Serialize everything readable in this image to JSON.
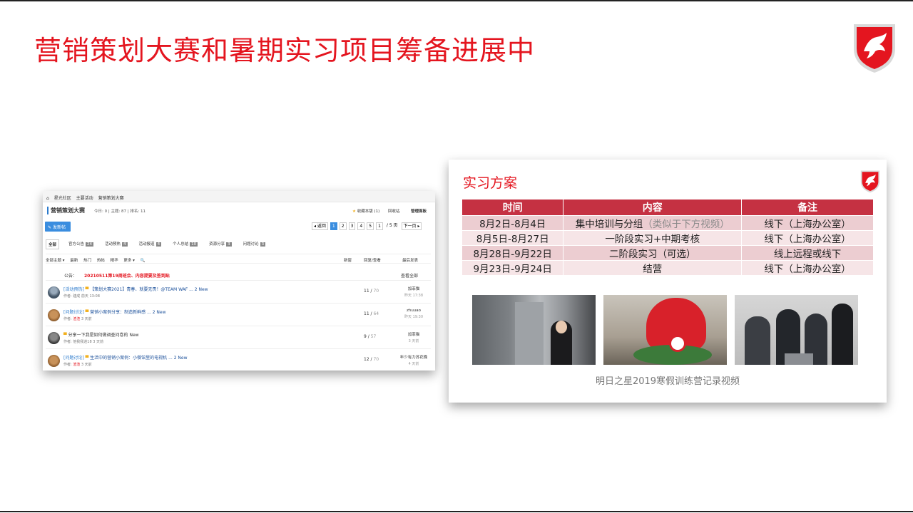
{
  "slide": {
    "title": "营销策划大赛和暑期实习项目筹备进展中",
    "accent": "#e4151f"
  },
  "forum": {
    "breadcrumb": [
      "⌂",
      "星光社区",
      "主要活动",
      "营销策划大赛"
    ],
    "title": "营销策划大赛",
    "stats": "今日: 0 | 主题: 87 | 排名: 11",
    "fav": "收藏本版 (1)",
    "recycle": "回收站",
    "admin": "管理面板",
    "post_button": "发新帖",
    "pager": [
      "◂ 返回",
      "1",
      "2",
      "3",
      "4",
      "5",
      "1",
      "/ 5 页",
      "下一页 ▸"
    ],
    "tabs": [
      {
        "label": "全部",
        "count": ""
      },
      {
        "label": "官方公告",
        "count": "24"
      },
      {
        "label": "活动预热",
        "count": "4"
      },
      {
        "label": "活动报道",
        "count": "4"
      },
      {
        "label": "个人总结",
        "count": "10"
      },
      {
        "label": "资源分享",
        "count": "3"
      },
      {
        "label": "问题讨论",
        "count": "3"
      }
    ],
    "filters": [
      "全部主题 ▾",
      "最新",
      "热门",
      "热帖",
      "精华",
      "更多 ▾",
      "🔍"
    ],
    "col_new": "新窗",
    "col_reply": "回复/查看",
    "col_last": "最后发表",
    "notice_label": "公告：",
    "notice_text": "20210511第19周班会、内容提要及签到贴",
    "notice_more": "查看全部",
    "rows": [
      {
        "tag": "[活动预热]",
        "title": "【策划大赛2021】青春、就要无畏！@TEAM WAF ... 2  New",
        "author_prefix": "作者: ",
        "author": "建成",
        "time": " 前天 13:08",
        "replies": "11",
        "views": "70",
        "last_user": "加菲猫",
        "last_time": "昨天 17:38"
      },
      {
        "tag": "[问题讨论]",
        "title": "营销小案例分享：制造新鲜感 ... 2  New",
        "author_prefix": "作者: ",
        "author": "渣渣",
        "time": " 3 天前",
        "replies": "11",
        "views": "64",
        "last_user": "zhuuao",
        "last_time": "昨天 19:30"
      },
      {
        "tag": "",
        "title": "分享一下我是如何做调查问卷的  New",
        "author_prefix": "作者: ",
        "author": "他我我迷18",
        "time": " 3 天前",
        "replies": "9",
        "views": "57",
        "last_user": "加菲猫",
        "last_time": "3 天前"
      },
      {
        "tag": "[问题讨论]",
        "title": "生活中的营销小案例：小餐馆里的电视机 ... 2  New",
        "author_prefix": "作者: ",
        "author": "渣渣",
        "time": " 3 天前",
        "replies": "12",
        "views": "70",
        "last_user": "年少有力苏花晚",
        "last_time": "4 天前"
      }
    ]
  },
  "plan": {
    "title": "实习方案",
    "headers": [
      "时间",
      "内容",
      "备注"
    ],
    "rows": [
      {
        "time": "8月2日-8月4日",
        "content": "集中培训与分组",
        "content_note": "（类似于下方视频）",
        "note": "线下（上海办公室）"
      },
      {
        "time": "8月5日-8月27日",
        "content": "一阶段实习+中期考核",
        "content_note": "",
        "note": "线下（上海办公室）"
      },
      {
        "time": "8月28日-9月22日",
        "content": "二阶段实习（可选）",
        "content_note": "",
        "note": "线上远程或线下"
      },
      {
        "time": "9月23日-9月24日",
        "content": "结营",
        "content_note": "",
        "note": "线下（上海办公室）"
      }
    ],
    "caption": "明日之星2019寒假训练营记录视频",
    "header_color": "#c53142"
  }
}
